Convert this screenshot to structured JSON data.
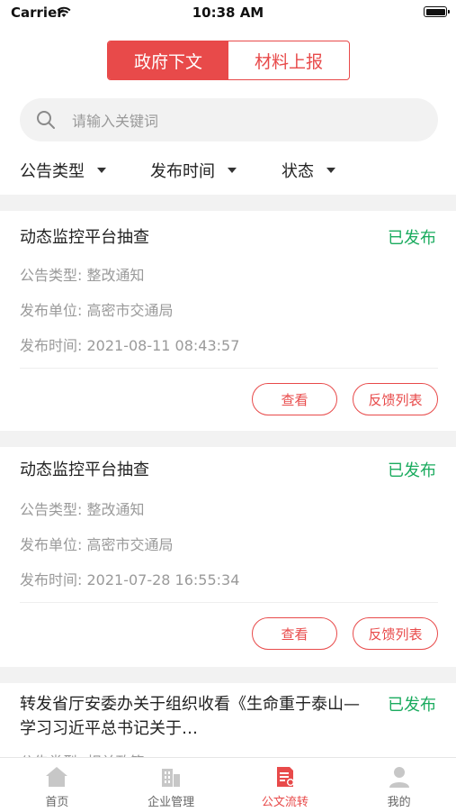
{
  "status_bar": {
    "carrier": "Carrier",
    "time": "10:38 AM"
  },
  "segment": {
    "tabs": [
      "政府下文",
      "材料上报"
    ],
    "active_index": 0
  },
  "search": {
    "placeholder": "请输入关键词",
    "value": ""
  },
  "filters": [
    {
      "label": "公告类型"
    },
    {
      "label": "发布时间"
    },
    {
      "label": "状态"
    }
  ],
  "cards": [
    {
      "title": "动态监控平台抽查",
      "status": "已发布",
      "type_line": "公告类型: 整改通知",
      "unit_line": "发布单位: 高密市交通局",
      "time_line": "发布时间: 2021-08-11 08:43:57",
      "view_label": "查看",
      "feedback_label": "反馈列表"
    },
    {
      "title": "动态监控平台抽查",
      "status": "已发布",
      "type_line": "公告类型: 整改通知",
      "unit_line": "发布单位: 高密市交通局",
      "time_line": "发布时间: 2021-07-28 16:55:34",
      "view_label": "查看",
      "feedback_label": "反馈列表"
    },
    {
      "title": "转发省厅安委办关于组织收看《生命重于泰山—学习习近平总书记关于…",
      "status": "已发布",
      "type_line": "公告类型: 相关政策"
    }
  ],
  "tabbar": {
    "items": [
      {
        "label": "首页",
        "icon": "home-icon"
      },
      {
        "label": "企业管理",
        "icon": "building-icon"
      },
      {
        "label": "公文流转",
        "icon": "document-icon"
      },
      {
        "label": "我的",
        "icon": "user-icon"
      }
    ],
    "active_index": 2
  },
  "colors": {
    "accent": "#e84a4a",
    "published": "#1aab5e",
    "muted": "#9a9a9a"
  }
}
